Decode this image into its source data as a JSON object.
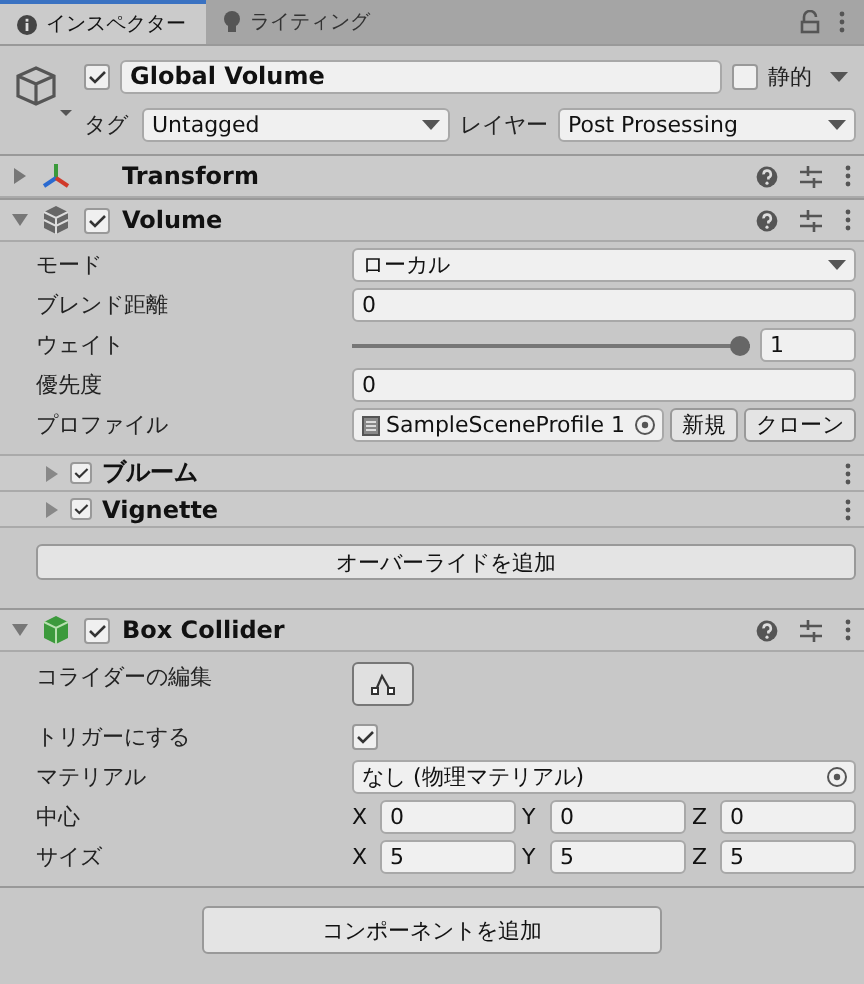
{
  "tabs": [
    {
      "label": "インスペクター",
      "selected": true
    },
    {
      "label": "ライティング",
      "selected": false
    }
  ],
  "object": {
    "enabled": true,
    "name": "Global Volume",
    "static_label": "静的",
    "static": false,
    "tag_label": "タグ",
    "tag": "Untagged",
    "layer_label": "レイヤー",
    "layer": "Post Prosessing"
  },
  "components": [
    {
      "kind": "transform",
      "title": "Transform",
      "expanded": false
    },
    {
      "kind": "volume",
      "title": "Volume",
      "enabled": true,
      "expanded": true,
      "properties": [
        {
          "kind": "dropdown",
          "label": "モード",
          "value": "ローカル"
        },
        {
          "kind": "number",
          "label": "ブレンド距離",
          "value": "0"
        },
        {
          "kind": "slider",
          "label": "ウェイト",
          "level": 1,
          "value": "1"
        },
        {
          "kind": "number",
          "label": "優先度",
          "value": "0"
        },
        {
          "kind": "object",
          "label": "プロファイル",
          "value": "SampleSceneProfile 1",
          "buttons": [
            "新規",
            "クローン"
          ]
        }
      ],
      "overrides": [
        {
          "title": "ブルーム",
          "enabled": true,
          "expanded": false
        },
        {
          "title": "Vignette",
          "enabled": true,
          "expanded": false
        }
      ],
      "add_override": "オーバーライドを追加"
    },
    {
      "kind": "box_collider",
      "title": "Box Collider",
      "enabled": true,
      "expanded": true,
      "properties": [
        {
          "kind": "edit_button",
          "label": "コライダーの編集"
        },
        {
          "kind": "checkbox",
          "label": "トリガーにする",
          "checked": true
        },
        {
          "kind": "object",
          "label": "マテリアル",
          "value": "なし (物理マテリアル)"
        },
        {
          "kind": "vector3",
          "label": "中心",
          "axes": [
            {
              "axis": "X",
              "value": "0"
            },
            {
              "axis": "Y",
              "value": "0"
            },
            {
              "axis": "Z",
              "value": "0"
            }
          ]
        },
        {
          "kind": "vector3",
          "label": "サイズ",
          "axes": [
            {
              "axis": "X",
              "value": "5"
            },
            {
              "axis": "Y",
              "value": "5"
            },
            {
              "axis": "Z",
              "value": "5"
            }
          ]
        }
      ]
    }
  ],
  "add_component": "コンポーネントを追加"
}
